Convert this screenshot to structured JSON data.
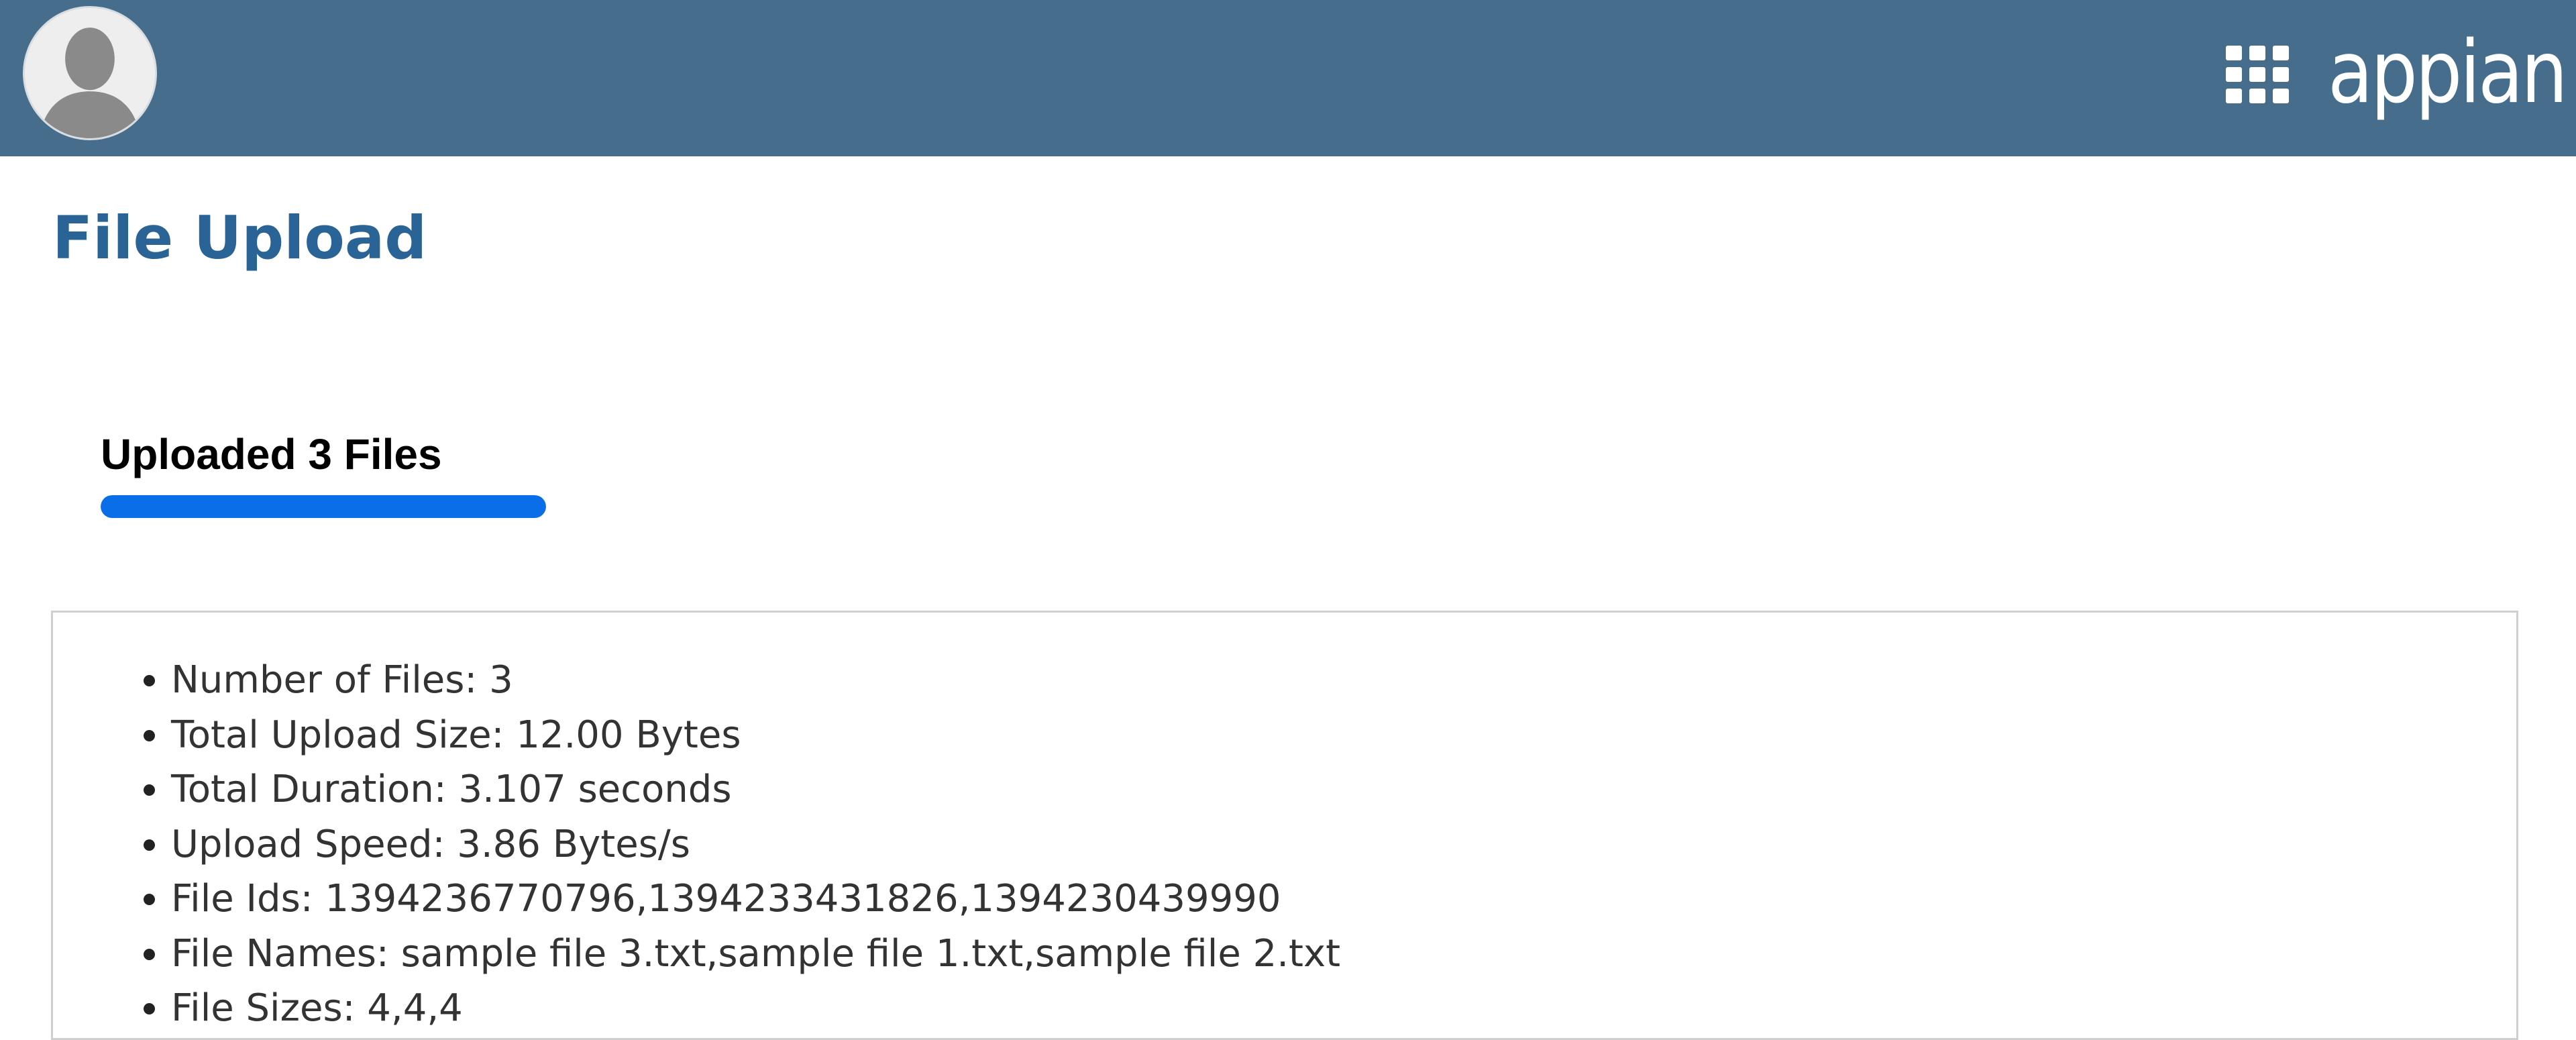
{
  "header": {
    "logo_text": "appian",
    "background_color": "#466e8c",
    "avatar_icon": "user-avatar-icon",
    "apps_icon": "grid-menu-icon"
  },
  "page": {
    "title": "File Upload",
    "title_color": "#2a6496"
  },
  "upload_progress": {
    "label": "Uploaded 3 Files",
    "percent": 100,
    "bar_color": "#0a6ee8"
  },
  "details": [
    "Number of Files: 3",
    "Total Upload Size: 12.00 Bytes",
    "Total Duration: 3.107 seconds",
    "Upload Speed: 3.86 Bytes/s",
    "File Ids: 1394236770796,1394233431826,1394230439990",
    "File Names: sample file 3.txt,sample file 1.txt,sample file 2.txt",
    "File Sizes: 4,4,4"
  ]
}
